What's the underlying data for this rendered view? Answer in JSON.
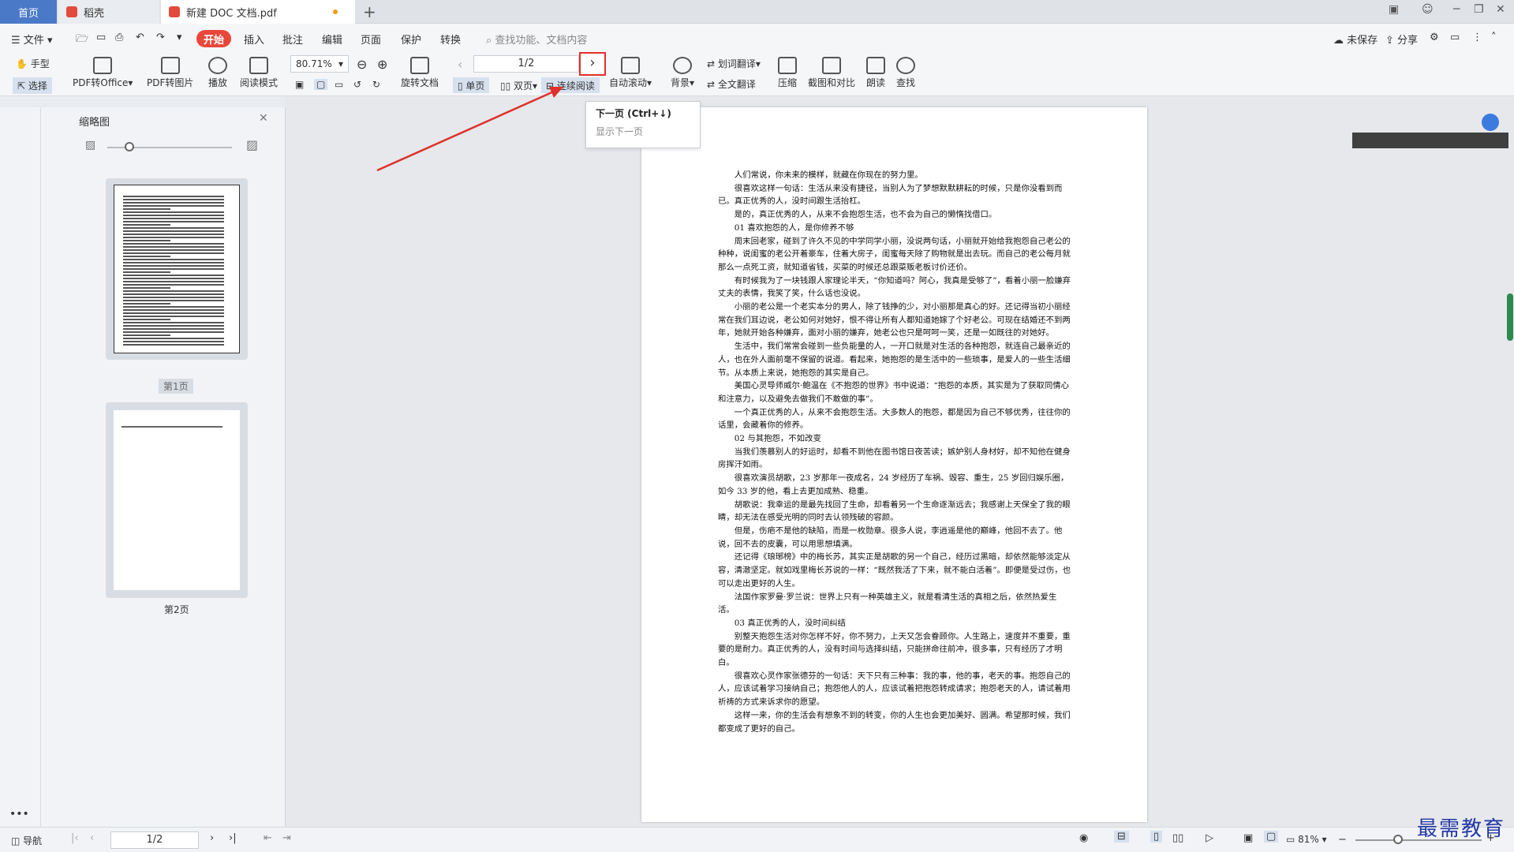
{
  "tabs": {
    "home": "首页",
    "wps": "稻壳",
    "doc": "新建 DOC 文档.pdf"
  },
  "menu": {
    "file": "文件",
    "start": "开始",
    "insert": "插入",
    "annotate": "批注",
    "edit": "编辑",
    "page": "页面",
    "protect": "保护",
    "convert": "转换",
    "search_placeholder": "查找功能、文档内容",
    "unsaved": "未保存",
    "share": "分享"
  },
  "toolbar": {
    "hand": "手型",
    "select": "选择",
    "pdf_to_office": "PDF转Office",
    "pdf_to_image": "PDF转图片",
    "play": "播放",
    "reading_mode": "阅读模式",
    "zoom": "80.71%",
    "rotate_doc": "旋转文档",
    "page_indicator": "1/2",
    "single_page": "单页",
    "double_page": "双页",
    "continuous": "连续阅读",
    "auto_scroll": "自动滚动",
    "word_translate": "划词翻译",
    "background": "背景",
    "full_translate": "全文翻译",
    "compress": "压缩",
    "screenshot_compare": "截图和对比",
    "read_aloud": "朗读",
    "find": "查找"
  },
  "tooltip": {
    "title": "下一页 (Ctrl+↓)",
    "desc": "显示下一页"
  },
  "thumbnails": {
    "title": "缩略图",
    "page1": "第1页",
    "page2": "第2页"
  },
  "status": {
    "nav": "导航",
    "page": "1/2",
    "zoom": "81%"
  },
  "watermark": "最需教育",
  "document": {
    "paragraphs": [
      "人们常说，你未来的模样，就藏在你现在的努力里。",
      "很喜欢这样一句话：生活从来没有捷径，当别人为了梦想默默耕耘的时候，只是你没看到而已。真正优秀的人，没时间跟生活抬杠。",
      "是的，真正优秀的人，从来不会抱怨生活，也不会为自己的懒惰找借口。",
      "01 喜欢抱怨的人，是你修养不够",
      "周末回老家，碰到了许久不见的中学同学小丽，没说两句话，小丽就开始给我抱怨自己老公的种种，说闺蜜的老公开着豪车，住着大房子，闺蜜每天除了购物就是出去玩。而自己的老公每月就那么一点死工资，就知道省钱，买菜的时候还总跟菜贩老板讨价还价。",
      "有时候我为了一块钱跟人家理论半天，“你知道吗？阿心，我真是受够了”，看着小丽一脸嫌弃丈夫的表情，我笑了笑，什么话也没说。",
      "小丽的老公是一个老实本分的男人，除了钱挣的少，对小丽那是真心的好。还记得当初小丽经常在我们耳边说，老公如何对她好，恨不得让所有人都知道她嫁了个好老公。可现在结婚还不到两年，她就开始各种嫌弃，面对小丽的嫌弃，她老公也只是呵呵一笑，还是一如既往的对她好。",
      "生活中，我们常常会碰到一些负能量的人，一开口就是对生活的各种抱怨，就连自己最亲近的人，也在外人面前毫不保留的说道。看起来，她抱怨的是生活中的一些琐事，是爱人的一些生活细节。从本质上来说，她抱怨的其实是自己。",
      "美国心灵导师威尔·鲍温在《不抱怨的世界》书中说道：“抱怨的本质，其实是为了获取同情心和注意力，以及避免去做我们不敢做的事”。",
      "一个真正优秀的人，从来不会抱怨生活。大多数人的抱怨，都是因为自己不够优秀，往往你的话里，会藏着你的修养。",
      "02 与其抱怨，不如改变",
      "当我们羡慕别人的好运时，却看不到他在图书馆日夜苦读；嫉妒别人身材好，却不知他在健身房挥汗如雨。",
      "很喜欢演员胡歌，23 岁那年一夜成名，24 岁经历了车祸、毁容、重生，25 岁回归娱乐圈，如今 33 岁的他，看上去更加成熟、稳重。",
      "胡歌说：我幸运的是最先找回了生命，却看着另一个生命逐渐远去；我感谢上天保全了我的眼睛，却无法在感受光明的同时去认领残破的容颜。",
      "但是，伤疤不是他的缺陷，而是一枚勋章。很多人说，李逍遥是他的巅峰，他回不去了。他说，回不去的皮囊，可以用思想填满。",
      "还记得《琅琊榜》中的梅长苏，其实正是胡歌的另一个自己，经历过黑暗，却依然能够淡定从容，清澈坚定。就如戏里梅长苏说的一样：“既然我活了下来，就不能白活着”。即便是受过伤，也可以走出更好的人生。",
      "法国作家罗曼·罗兰说：世界上只有一种英雄主义，就是看清生活的真相之后，依然热爱生活。",
      "03 真正优秀的人，没时间纠结",
      "别整天抱怨生活对你怎样不好，你不努力，上天又怎会眷顾你。人生路上，速度并不重要，重要的是耐力。真正优秀的人，没有时间与选择纠结，只能拼命往前冲，很多事，只有经历了才明白。",
      "很喜欢心灵作家张德芬的一句话：天下只有三种事：我的事，他的事，老天的事。抱怨自己的人，应该试着学习接纳自己；抱怨他人的人，应该试着把抱怨转成请求；抱怨老天的人，请试着用祈祷的方式来诉求你的愿望。",
      "这样一来，你的生活会有想象不到的转变，你的人生也会更加美好、圆满。希望那时候，我们都变成了更好的自己。"
    ]
  }
}
